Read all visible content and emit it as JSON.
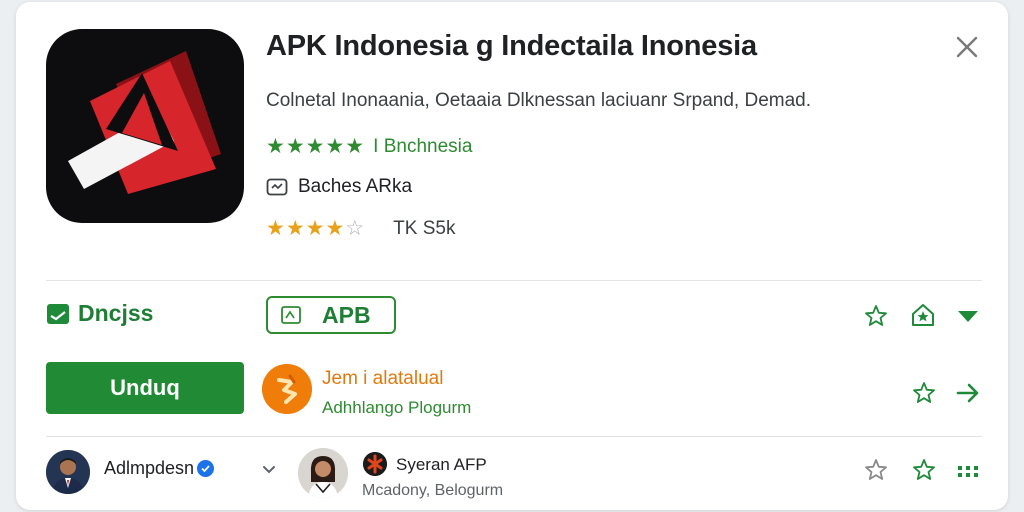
{
  "app": {
    "title": "APK Indonesia g Indectaila Inonesia",
    "subtitle": "Colnetal  Inonaania, Oetaaia  Dlknessan laciuanr Srpand, Demad.",
    "developer_link": "I Bnchnesia",
    "badge_text": "Baches ARka",
    "size_text": "TK S5k",
    "rating_primary": 5,
    "rating_secondary": 4
  },
  "category": {
    "label": "Dncjss",
    "chip_label": "APB"
  },
  "download": {
    "label": "Unduq"
  },
  "promo": {
    "title": "Jem  i alatalual",
    "subtitle": "Adhhlango Plogurm"
  },
  "user": {
    "name": "Adlmpdesn"
  },
  "secondary": {
    "name": "Syeran AFP",
    "subtitle": "Mcadony, Belogurm"
  },
  "colors": {
    "accent_green": "#218a35",
    "star_green": "#2e8b32",
    "star_orange": "#e8a11a",
    "promo_orange": "#f07d0a",
    "icon_red": "#d7262b"
  },
  "icons": [
    "close-icon",
    "star-icon",
    "house-star-icon",
    "triangle-down-icon",
    "arrow-right-icon",
    "more-dots-icon",
    "chevron-down-icon",
    "verified-icon"
  ]
}
